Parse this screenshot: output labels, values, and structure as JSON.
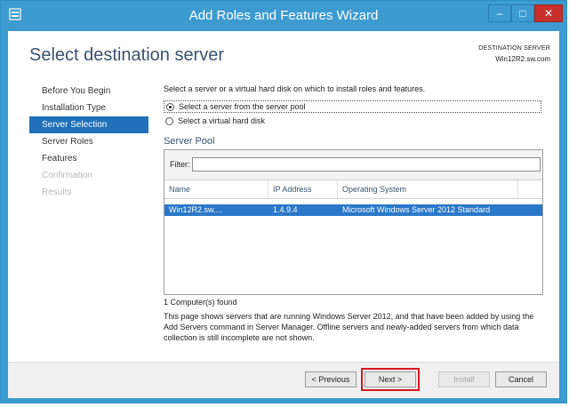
{
  "window": {
    "title": "Add Roles and Features Wizard",
    "controls": {
      "minimize": "–",
      "maximize": "□",
      "close": "✕"
    }
  },
  "header": {
    "page_title": "Select destination server",
    "destination_label": "DESTINATION SERVER",
    "destination_value": "Win12R2.sw.com"
  },
  "nav": {
    "items": [
      {
        "label": "Before You Begin",
        "state": "normal"
      },
      {
        "label": "Installation Type",
        "state": "normal"
      },
      {
        "label": "Server Selection",
        "state": "active"
      },
      {
        "label": "Server Roles",
        "state": "normal"
      },
      {
        "label": "Features",
        "state": "normal"
      },
      {
        "label": "Confirmation",
        "state": "disabled"
      },
      {
        "label": "Results",
        "state": "disabled"
      }
    ]
  },
  "content": {
    "instruction": "Select a server or a virtual hard disk on which to install roles and features.",
    "options": [
      {
        "label": "Select a server from the server pool",
        "checked": true
      },
      {
        "label": "Select a virtual hard disk",
        "checked": false
      }
    ],
    "pool_title": "Server Pool",
    "filter_label": "Filter:",
    "filter_value": "",
    "columns": {
      "name": "Name",
      "ip": "IP Address",
      "os": "Operating System"
    },
    "rows": [
      {
        "name": "Win12R2.sw....",
        "ip": "1.4.9.4",
        "os": "Microsoft Windows Server 2012 Standard"
      }
    ],
    "count_text": "1 Computer(s) found",
    "description": "This page shows servers that are running Windows Server 2012, and that have been added by using the Add Servers command in Server Manager. Offline servers and newly-added servers from which data collection is still incomplete are not shown."
  },
  "footer": {
    "previous_label": "< Previous",
    "next_label": "Next >",
    "install_label": "Install",
    "cancel_label": "Cancel"
  },
  "colors": {
    "titlebar": "#3d9bd0",
    "nav_active": "#1f70b8",
    "selected_row": "#2a78c8",
    "highlight_box": "#d6181f"
  }
}
